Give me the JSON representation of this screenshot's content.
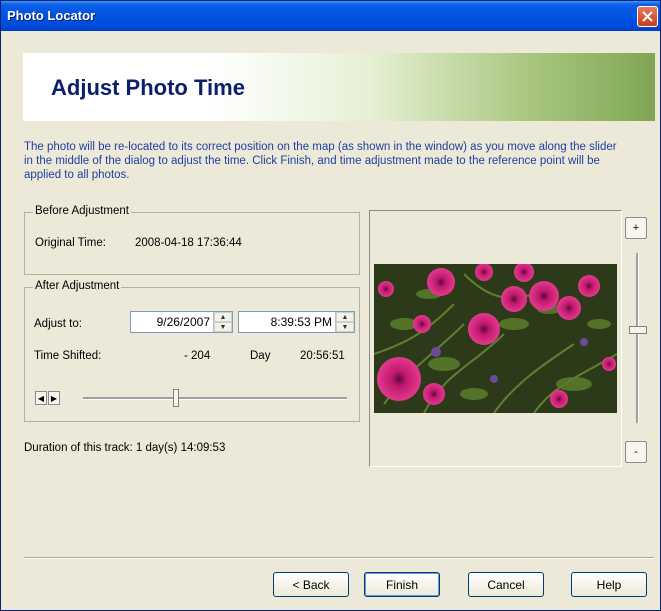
{
  "window": {
    "title": "Photo Locator"
  },
  "banner": {
    "heading": "Adjust Photo Time"
  },
  "instructions": "The photo will be re-located to its correct position on the map (as shown in the window) as you move along the slider in the middle of the dialog to adjust the time. Click Finish, and time adjustment made to the reference point will be applied to all photos.",
  "before": {
    "legend": "Before Adjustment",
    "original_label": "Original Time:",
    "original_value": "2008-04-18 17:36:44"
  },
  "after": {
    "legend": "After Adjustment",
    "adjust_label": "Adjust to:",
    "date_value": "9/26/2007",
    "time_value": "8:39:53 PM",
    "shift_label": "Time Shifted:",
    "shift_days": "- 204",
    "shift_unit": "Day",
    "shift_time": "20:56:51",
    "slider_level": 0.35
  },
  "duration": "Duration of this track:  1 day(s) 14:09:53",
  "zoom": {
    "plus": "+",
    "minus": "-",
    "level": 0.45
  },
  "buttons": {
    "back": "< Back",
    "finish": "Finish",
    "cancel": "Cancel",
    "help": "Help"
  }
}
